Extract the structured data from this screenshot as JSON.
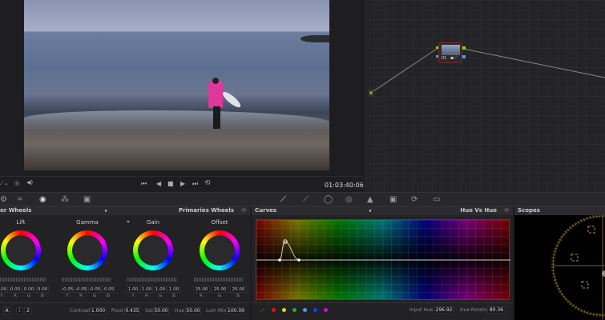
{
  "viewer": {
    "timecode": "01:03:40:06"
  },
  "node": {
    "label": "01"
  },
  "toolbar": {
    "icons": [
      "camera-raw-icon",
      "color-match-icon",
      "color-wheels-icon",
      "rgb-mixer-icon",
      "motion-effects-icon",
      "curves-icon",
      "qualifier-icon",
      "window-icon",
      "tracker-icon",
      "blur-icon",
      "key-icon",
      "sizing-icon",
      "3d-icon"
    ]
  },
  "wheels": {
    "title": "or Wheels",
    "mode": "Primaries Wheels",
    "items": [
      {
        "label": "Lift",
        "values": [
          "0.00",
          "0.00",
          "0.00",
          "0.00"
        ],
        "channels": [
          "Y",
          "R",
          "G",
          "B"
        ]
      },
      {
        "label": "Gamma",
        "values": [
          "-0.05",
          "-0.05",
          "-0.05",
          "-0.05"
        ],
        "channels": [
          "Y",
          "R",
          "G",
          "B"
        ]
      },
      {
        "label": "Gain",
        "values": [
          "1.00",
          "1.00",
          "1.00",
          "1.00"
        ],
        "channels": [
          "Y",
          "R",
          "G",
          "B"
        ]
      },
      {
        "label": "Offset",
        "values": [
          "25.00",
          "25.00",
          "25.00"
        ],
        "channels": [
          "R",
          "G",
          "B"
        ]
      }
    ],
    "pages": [
      "1",
      "2"
    ],
    "contrast_label": "Contrast",
    "contrast": "1.000",
    "pivot_label": "Pivot",
    "pivot": "0.435",
    "sat_label": "Sat",
    "sat": "50.00",
    "hue_label": "Hue",
    "hue": "50.00",
    "lummix_label": "Lum Mix",
    "lummix": "100.00"
  },
  "curves": {
    "title": "Curves",
    "mode": "Hue Vs Hue",
    "input_hue_label": "Input Hue",
    "input_hue": "296.92",
    "hue_rotate_label": "Hue Rotate",
    "hue_rotate": "80.36",
    "swatches": [
      "#e0101a",
      "#e6d800",
      "#20b020",
      "#40a0f0",
      "#1040f0",
      "#d010d0"
    ]
  },
  "scopes": {
    "title": "Scopes"
  }
}
